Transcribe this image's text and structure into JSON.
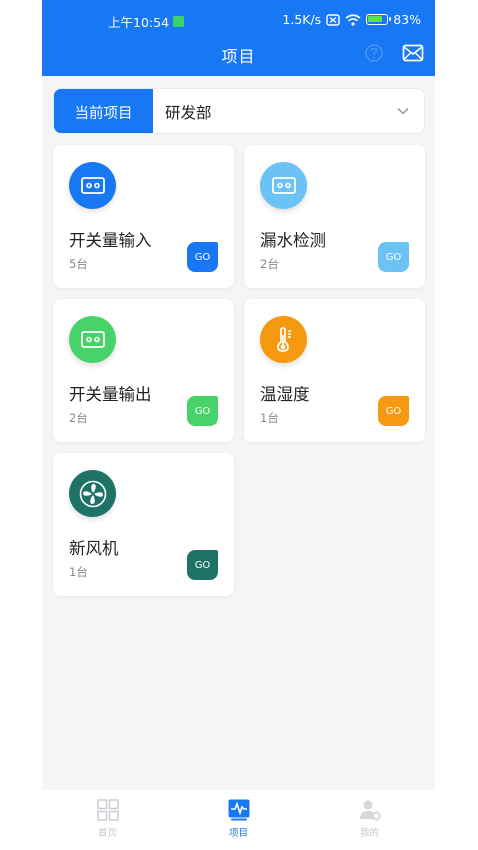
{
  "status_bar": {
    "time": "上午10:54",
    "network_speed": "1.5K/s",
    "battery": "83%"
  },
  "header": {
    "title": "项目"
  },
  "project_selector": {
    "tab_label": "当前项目",
    "value": "研发部"
  },
  "colors": {
    "primary": "#1877f2",
    "card_blue": "#1877f2",
    "card_light_blue": "#6ac3f4",
    "card_green": "#48d26a",
    "card_orange": "#f59910",
    "card_teal": "#1f7366"
  },
  "cards": [
    {
      "title": "开关量输入",
      "count": "5台",
      "go": "GO",
      "icon": "switch-box-icon"
    },
    {
      "title": "漏水检测",
      "count": "2台",
      "go": "GO",
      "icon": "water-leak-icon"
    },
    {
      "title": "开关量输出",
      "count": "2台",
      "go": "GO",
      "icon": "switch-box-icon"
    },
    {
      "title": "温湿度",
      "count": "1台",
      "go": "GO",
      "icon": "thermometer-icon"
    },
    {
      "title": "新风机",
      "count": "1台",
      "go": "GO",
      "icon": "fan-icon"
    }
  ],
  "bottom_nav": [
    {
      "label": "首页",
      "icon": "grid-icon",
      "active": false
    },
    {
      "label": "项目",
      "icon": "activity-icon",
      "active": true
    },
    {
      "label": "我的",
      "icon": "user-settings-icon",
      "active": false
    }
  ]
}
